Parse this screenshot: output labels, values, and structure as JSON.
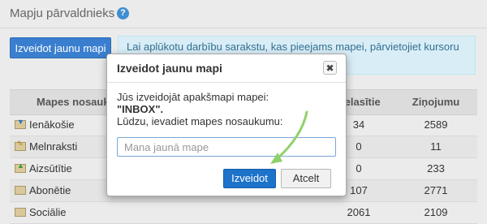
{
  "header": {
    "title": "Mapju pārvaldnieks",
    "help_icon": "?"
  },
  "toolbar": {
    "create_label": "Izveidot jaunu mapi"
  },
  "info": {
    "text": "Lai aplūkotu darbību sarakstu, kas pieejams mapei, pārvietojiet kursoru"
  },
  "table": {
    "columns": {
      "name": "Mapes nosaukums",
      "unread": "Nelasītie",
      "messages": "Ziņojumu"
    },
    "rows": [
      {
        "name": "Ienākošie",
        "icon": "inbox-folder-icon",
        "unread": "34",
        "messages": "2589"
      },
      {
        "name": "Melnraksti",
        "icon": "drafts-folder-icon",
        "unread": "0",
        "messages": "11"
      },
      {
        "name": "Aizsūtītie",
        "icon": "sent-folder-icon",
        "unread": "0",
        "messages": "233"
      },
      {
        "name": "Abonētie",
        "icon": "subscribed-folder-icon",
        "unread": "107",
        "messages": "2771"
      },
      {
        "name": "Sociālie",
        "icon": "social-folder-icon",
        "unread": "2061",
        "messages": "2109"
      }
    ]
  },
  "dialog": {
    "title": "Izveidot jaunu mapi",
    "close_icon": "✖",
    "line1": "Jūs izveidojāt apakšmapi mapei:",
    "folder_quoted": "\"INBOX\".",
    "line3": "Lūdzu, ievadiet mapes nosaukumu:",
    "input_value": "",
    "input_placeholder": "Mana jaunā mape",
    "create_label": "Izveidot",
    "cancel_label": "Atcelt"
  },
  "colors": {
    "primary": "#1d72c9",
    "annotation_arrow": "#8fd16a",
    "info_bg": "#d9edf7"
  }
}
